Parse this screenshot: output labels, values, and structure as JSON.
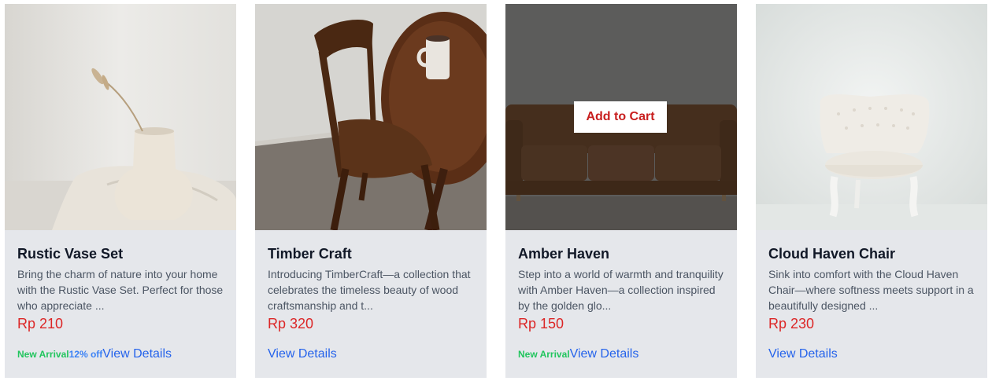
{
  "products": [
    {
      "title": "Rustic Vase Set",
      "description": "Bring the charm of nature into your home with the Rustic Vase Set. Perfect for those who appreciate ...",
      "price": "Rp 210",
      "badge_new": "New Arrival",
      "badge_discount": "12% off",
      "details_label": "View Details"
    },
    {
      "title": "Timber Craft",
      "description": "Introducing TimberCraft—a collection that celebrates the timeless beauty of wood craftsmanship and t...",
      "price": "Rp 320",
      "details_label": "View Details"
    },
    {
      "title": "Amber Haven",
      "description": "Step into a world of warmth and tranquility with Amber Haven—a collection inspired by the golden glo...",
      "price": "Rp 150",
      "badge_new": "New Arrival",
      "details_label": "View Details",
      "add_to_cart_label": "Add to Cart"
    },
    {
      "title": "Cloud Haven Chair",
      "description": "Sink into comfort with the Cloud Haven Chair—where softness meets support in a beautifully designed ...",
      "price": "Rp 230",
      "details_label": "View Details"
    }
  ],
  "colors": {
    "card_bg": "#e5e7eb",
    "price": "#dc2626",
    "badge_new": "#22c55e",
    "badge_discount": "#3b82f6",
    "link": "#2563eb",
    "add_to_cart_text": "#c81e1e"
  }
}
